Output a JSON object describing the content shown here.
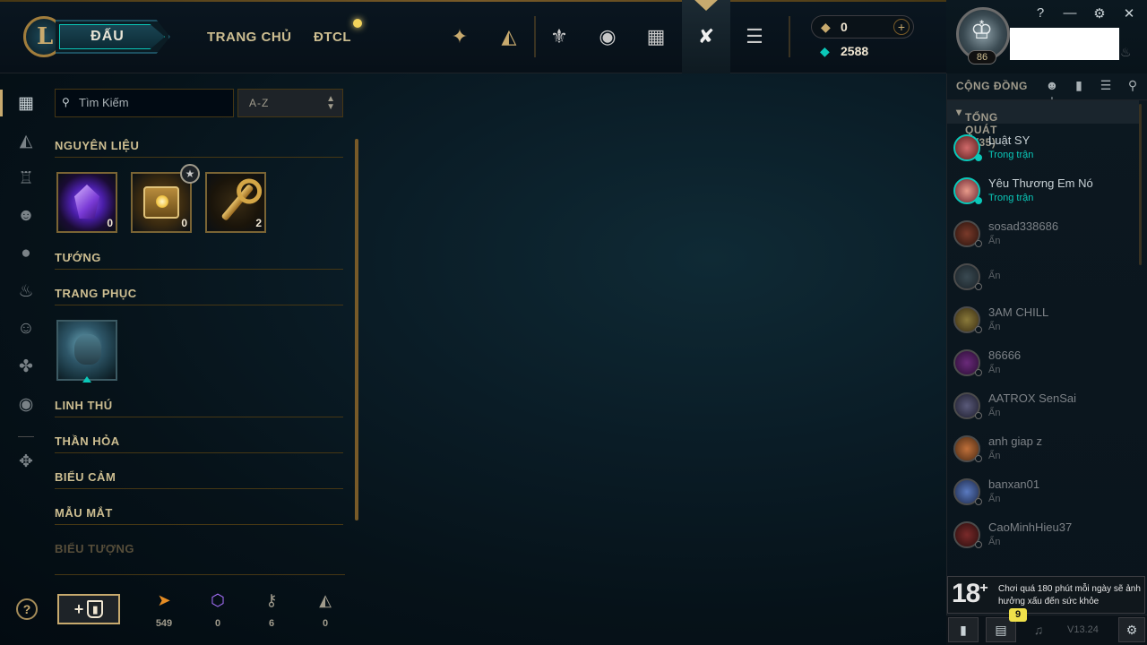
{
  "topbar": {
    "logo_letter": "L",
    "play_label": "ĐẤU",
    "nav": [
      "TRANG CHỦ",
      "ĐTCL"
    ],
    "icons": [
      "tft-icon",
      "collection-icon",
      "clash-icon",
      "profile-icon",
      "loot-icon",
      "store-icon",
      "coins-icon"
    ],
    "rp_value": "0",
    "be_value": "2588",
    "add_symbol": "+"
  },
  "profile": {
    "level": "86",
    "window_controls": [
      "?",
      "—",
      "⚙",
      "✕"
    ]
  },
  "left_nav": {
    "items": [
      "all-loot-icon",
      "chest-icon",
      "helmet-icon",
      "mask-icon",
      "ward-icon",
      "flame-icon",
      "emote-icon",
      "icon-icon",
      "profile-icon-icon",
      "eternals-icon"
    ],
    "help_label": "?"
  },
  "loot_panel": {
    "search_placeholder": "Tìm Kiếm",
    "sort_value": "A-Z",
    "sections": {
      "materials": "NGUYÊN LIỆU",
      "champions": "TƯỚNG",
      "skins": "TRANG PHỤC",
      "pets": "LINH THÚ",
      "wards": "THẦN HỎA",
      "emotes": "BIỂU CẢM",
      "eye_colors": "MẪU MẮT",
      "icons": "BIỂU TƯỢNG"
    },
    "materials": [
      {
        "name": "gem-loot",
        "count": "0"
      },
      {
        "name": "chest-loot",
        "count": "0"
      },
      {
        "name": "key-loot",
        "count": "2"
      }
    ],
    "craft_plus": "+",
    "resources": [
      {
        "name": "orange-essence",
        "value": "549",
        "color": "#e58c24"
      },
      {
        "name": "mythic-essence",
        "value": "0",
        "color": "#a971ff"
      },
      {
        "name": "key-fragment",
        "value": "6",
        "color": "#a09b8c"
      },
      {
        "name": "chest-resource",
        "value": "0",
        "color": "#a09b8c"
      }
    ]
  },
  "social": {
    "title": "CỘNG ĐỒNG",
    "group_label": "TỔNG QUÁT (2/35)",
    "friends": [
      {
        "name": "Luật SY",
        "status": "Trong trận",
        "online": true
      },
      {
        "name": "Yêu Thương Em Nó",
        "status": "Trong trận",
        "online": true
      },
      {
        "name": "sosad338686",
        "status": "Ẩn",
        "online": false
      },
      {
        "name": "",
        "status": "Ẩn",
        "online": false
      },
      {
        "name": "3AM CHILL",
        "status": "Ẩn",
        "online": false
      },
      {
        "name": "86666",
        "status": "Ẩn",
        "online": false
      },
      {
        "name": "AATROX SenSai",
        "status": "Ẩn",
        "online": false
      },
      {
        "name": "anh giap z",
        "status": "Ẩn",
        "online": false
      },
      {
        "name": "banxan01",
        "status": "Ẩn",
        "online": false
      },
      {
        "name": "CaoMinhHieu37",
        "status": "Ẩn",
        "online": false
      }
    ],
    "age_rating": "18",
    "age_plus": "+",
    "age_warning": "Chơi quá 180 phút mỗi ngày sẽ ảnh hưởng xấu đến sức khỏe",
    "mission_badge": "9",
    "version": "V13.24"
  }
}
